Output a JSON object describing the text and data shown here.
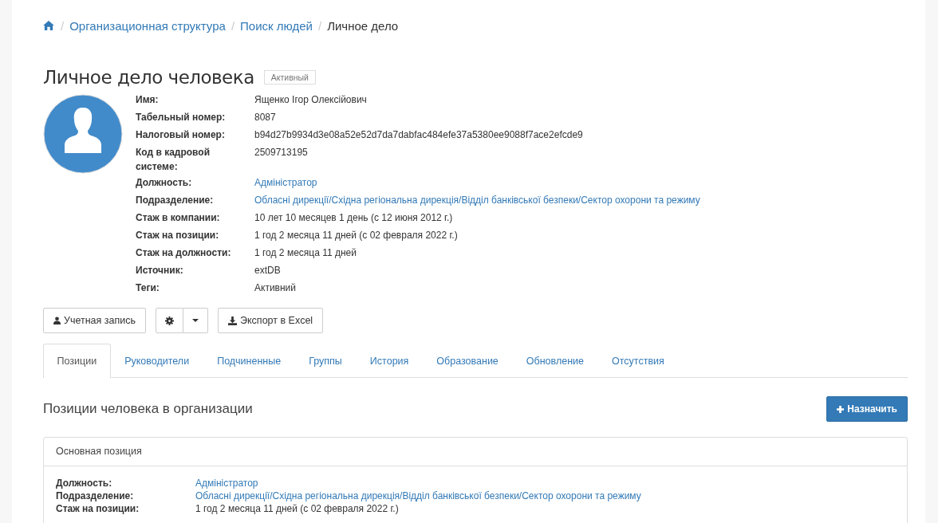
{
  "breadcrumb_separator": "/",
  "breadcrumb": [
    {
      "kind": "home"
    },
    {
      "kind": "link",
      "label": "Организационная структура"
    },
    {
      "kind": "link",
      "label": "Поиск людей"
    },
    {
      "kind": "current",
      "label": "Личное дело"
    }
  ],
  "profile": {
    "title": "Личное дело человека",
    "status_badge": "Активный",
    "fields": [
      {
        "label": "Имя:",
        "value": "Ященко Ігор Олексійович",
        "kind": "text"
      },
      {
        "label": "Табельный номер:",
        "value": "8087",
        "kind": "text"
      },
      {
        "label": "Налоговый номер:",
        "value": "b94d27b9934d3e08a52e52d7da7dabfac484efe37a5380ee9088f7ace2efcde9",
        "kind": "text"
      },
      {
        "label": "Код в кадровой системе:",
        "value": "2509713195",
        "kind": "text"
      },
      {
        "label": "Должность:",
        "value": "Адміністратор",
        "kind": "link"
      },
      {
        "label": "Подразделение:",
        "value": "Обласні дирекції/Східна регіональна дирекція/Відділ банківської безпеки/Сектор охорони та режиму",
        "kind": "link"
      },
      {
        "label": "Стаж в компании:",
        "value": "10 лет 10 месяцев 1 день (с 12 июня 2012 г.)",
        "kind": "text"
      },
      {
        "label": "Стаж на позиции:",
        "value": "1 год 2 месяца 11 дней (с 02 февраля 2022 г.)",
        "kind": "text"
      },
      {
        "label": "Стаж на должности:",
        "value": "1 год 2 месяца 11 дней",
        "kind": "text"
      },
      {
        "label": "Источник:",
        "value": "extDB",
        "kind": "text"
      },
      {
        "label": "Теги:",
        "value": "Активний",
        "kind": "text"
      }
    ]
  },
  "actions": {
    "account_button": "Учетная запись",
    "export_button": "Экспорт в Excel"
  },
  "tabs": [
    {
      "label": "Позиции",
      "selected": true
    },
    {
      "label": "Руководители",
      "selected": false
    },
    {
      "label": "Подчиненные",
      "selected": false
    },
    {
      "label": "Группы",
      "selected": false
    },
    {
      "label": "История",
      "selected": false
    },
    {
      "label": "Образование",
      "selected": false
    },
    {
      "label": "Обновление",
      "selected": false
    },
    {
      "label": "Отсутствия",
      "selected": false
    }
  ],
  "positions": {
    "heading": "Позиции человека в организации",
    "assign_button": "Назначить",
    "panel": {
      "title": "Основная позиция",
      "fields": [
        {
          "label": "Должность:",
          "value": "Адміністратор",
          "kind": "link"
        },
        {
          "label": "Подразделение:",
          "value": "Обласні дирекції/Східна регіональна дирекція/Відділ банківської безпеки/Сектор охорони та режиму",
          "kind": "link"
        },
        {
          "label": "Стаж на позиции:",
          "value": "1 год 2 месяца 11 дней (с 02 февраля 2022 г.)",
          "kind": "text"
        }
      ]
    }
  }
}
